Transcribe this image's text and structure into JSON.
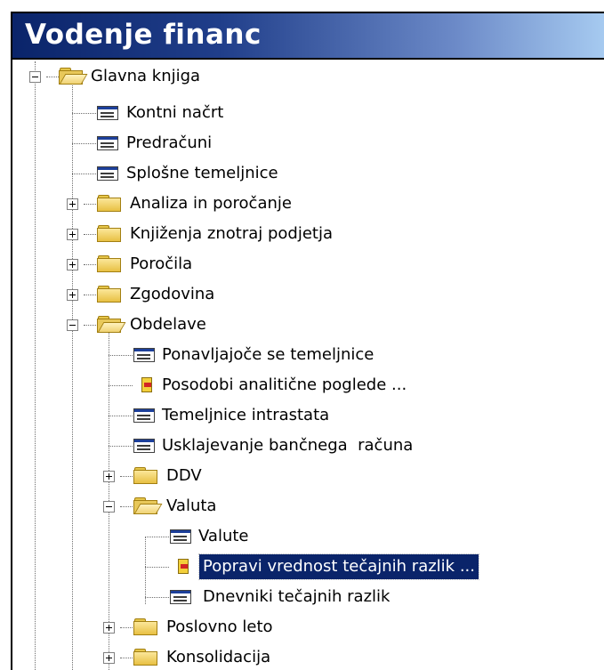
{
  "window": {
    "title": "Vodenje financ"
  },
  "tree": {
    "items": [
      {
        "label": "Glavna knjiga",
        "icon": "folder-open-icon"
      },
      {
        "label": "Kontni načrt",
        "icon": "form-icon"
      },
      {
        "label": "Predračuni",
        "icon": "form-icon"
      },
      {
        "label": "Splošne temeljnice",
        "icon": "form-icon"
      },
      {
        "label": "Analiza in poročanje",
        "icon": "folder-icon"
      },
      {
        "label": "Knjiženja znotraj podjetja",
        "icon": "folder-icon"
      },
      {
        "label": "Poročila",
        "icon": "folder-icon"
      },
      {
        "label": "Zgodovina",
        "icon": "folder-icon"
      },
      {
        "label": "Obdelave",
        "icon": "folder-open-icon"
      },
      {
        "label": "Ponavljajoče se temeljnice",
        "icon": "form-icon"
      },
      {
        "label": "Posodobi analitične poglede ...",
        "icon": "report-icon"
      },
      {
        "label": "Temeljnice intrastata",
        "icon": "form-icon"
      },
      {
        "label": "Usklajevanje bančnega  računa",
        "icon": "form-icon"
      },
      {
        "label": "DDV",
        "icon": "folder-icon"
      },
      {
        "label": "Valuta",
        "icon": "folder-open-icon"
      },
      {
        "label": "Valute",
        "icon": "form-icon"
      },
      {
        "label": "Popravi vrednost tečajnih razlik ...",
        "icon": "report-icon",
        "selected": true
      },
      {
        "label": "Dnevniki tečajnih razlik",
        "icon": "form-icon"
      },
      {
        "label": "Poslovno leto",
        "icon": "folder-icon"
      },
      {
        "label": "Konsolidacija",
        "icon": "folder-icon"
      }
    ]
  }
}
